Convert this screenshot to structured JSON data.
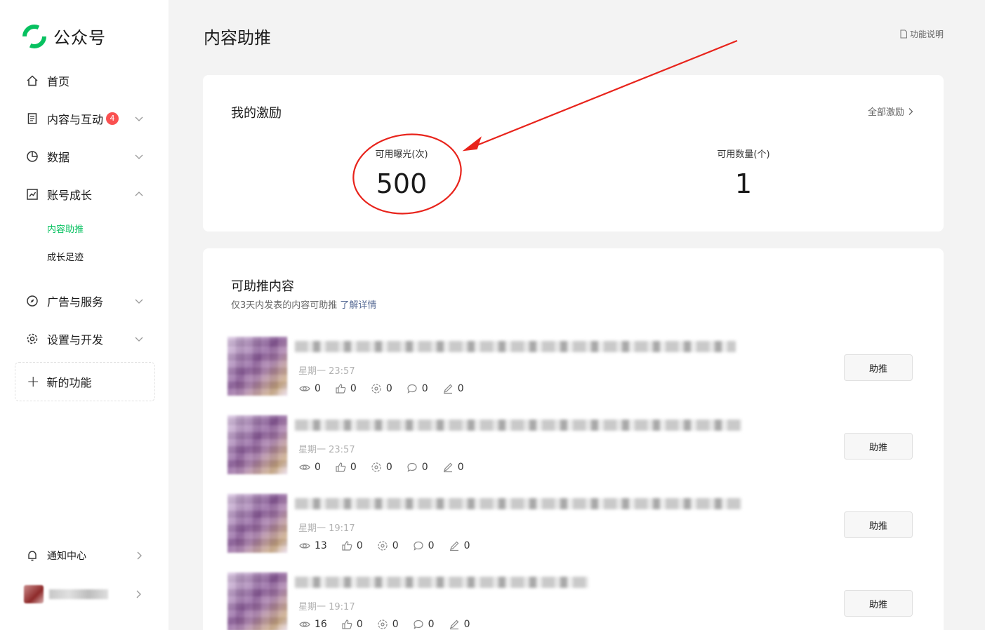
{
  "app": {
    "name": "公众号"
  },
  "sidebar": {
    "items": [
      {
        "label": "首页"
      },
      {
        "label": "内容与互动",
        "badge": "4"
      },
      {
        "label": "数据"
      },
      {
        "label": "账号成长"
      },
      {
        "label": "广告与服务"
      },
      {
        "label": "设置与开发"
      }
    ],
    "sub_items": [
      {
        "label": "内容助推",
        "active": true
      },
      {
        "label": "成长足迹"
      }
    ],
    "new_features": "新的功能",
    "notifications": "通知中心"
  },
  "header": {
    "title": "内容助推",
    "help": "功能说明"
  },
  "incentive": {
    "title": "我的激励",
    "all_link": "全部激励",
    "stats": [
      {
        "label": "可用曝光(次)",
        "value": "500"
      },
      {
        "label": "可用数量(个)",
        "value": "1"
      }
    ]
  },
  "content": {
    "title": "可助推内容",
    "desc": "仅3天内发表的内容可助推",
    "desc_link": "了解详情",
    "rows": [
      {
        "time": "星期一 23:57",
        "views": "0",
        "likes": "0",
        "shares": "0",
        "comments": "0",
        "edits": "0",
        "button": "助推"
      },
      {
        "time": "星期一 23:57",
        "views": "0",
        "likes": "0",
        "shares": "0",
        "comments": "0",
        "edits": "0",
        "button": "助推"
      },
      {
        "time": "星期一 19:17",
        "views": "13",
        "likes": "0",
        "shares": "0",
        "comments": "0",
        "edits": "0",
        "button": "助推"
      },
      {
        "time": "星期一 19:17",
        "views": "16",
        "likes": "0",
        "shares": "0",
        "comments": "0",
        "edits": "0",
        "button": "助推"
      }
    ]
  },
  "colors": {
    "accent": "#07c160",
    "badge": "#fa5151",
    "link": "#576b95",
    "annotation": "#e8231b"
  }
}
